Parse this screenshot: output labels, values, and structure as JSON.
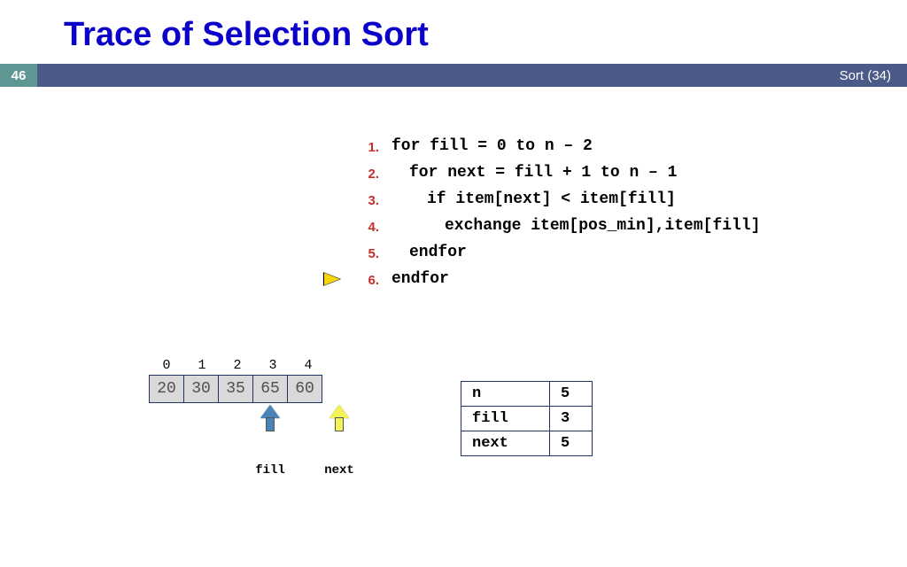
{
  "title": "Trace of Selection Sort",
  "page_number": "46",
  "footer_label": "Sort (34)",
  "code": {
    "lines": [
      {
        "n": "1.",
        "text": "for fill = 0 to n – 2",
        "indent": 0
      },
      {
        "n": "2.",
        "text": "for next = fill + 1 to n – 1",
        "indent": 1
      },
      {
        "n": "3.",
        "text": "if item[next] < item[fill]",
        "indent": 2
      },
      {
        "n": "4.",
        "text": "exchange item[pos_min],item[fill]",
        "indent": 3
      },
      {
        "n": "5.",
        "text": "endfor",
        "indent": 1
      },
      {
        "n": "6.",
        "text": "endfor",
        "indent": 0
      }
    ],
    "pointer_line": 6
  },
  "array": {
    "indices": [
      "0",
      "1",
      "2",
      "3",
      "4"
    ],
    "values": [
      "20",
      "30",
      "35",
      "65",
      "60"
    ],
    "fill_index": 3,
    "next_index": 5,
    "fill_label": "fill",
    "next_label": "next"
  },
  "vars": [
    {
      "name": "n",
      "value": "5"
    },
    {
      "name": "fill",
      "value": "3"
    },
    {
      "name": "next",
      "value": "5"
    }
  ]
}
